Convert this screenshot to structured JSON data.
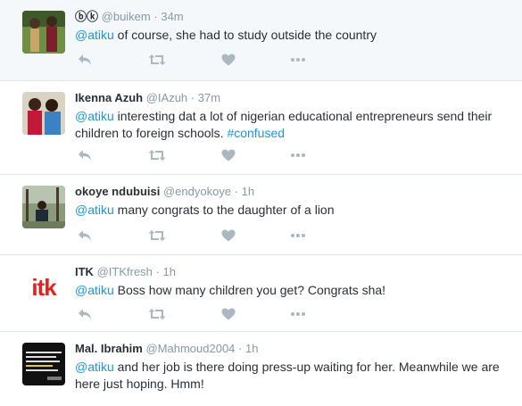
{
  "tweets": [
    {
      "fullname": "ⓑⓚ",
      "username": "@buikem",
      "sep": "·",
      "time": "34m",
      "mention": "@atiku",
      "text": " of course, she had to study outside the country",
      "hashtag": ""
    },
    {
      "fullname": "Ikenna Azuh",
      "username": "@IAzuh",
      "sep": "·",
      "time": "37m",
      "mention": "@atiku",
      "text": " interesting dat a lot of nigerian educational entrepreneurs send their children to foreign schools. ",
      "hashtag": "#confused"
    },
    {
      "fullname": "okoye ndubuisi",
      "username": "@endyokoye",
      "sep": "·",
      "time": "1h",
      "mention": "@atiku",
      "text": " many congrats to the daughter of a lion",
      "hashtag": ""
    },
    {
      "fullname": "ITK",
      "username": "@ITKfresh",
      "sep": "·",
      "time": "1h",
      "mention": "@atiku",
      "text": " Boss how many children you get? Congrats sha!",
      "hashtag": "",
      "avatar_text": "itk"
    },
    {
      "fullname": "Mal. Ibrahim",
      "username": "@Mahmoud2004",
      "sep": "·",
      "time": "1h",
      "mention": "@atiku",
      "text": " and her job is there doing press-up waiting for her. Meanwhile we are here just hoping. Hmm!",
      "hashtag": ""
    }
  ],
  "icons": {
    "reply": "reply-icon",
    "retweet": "retweet-icon",
    "like": "heart-icon",
    "more": "more-icon"
  },
  "colors": {
    "link": "#1b95e0",
    "muted": "#8899a6",
    "icon": "#aab8c2",
    "itk_red": "#e0231b"
  }
}
